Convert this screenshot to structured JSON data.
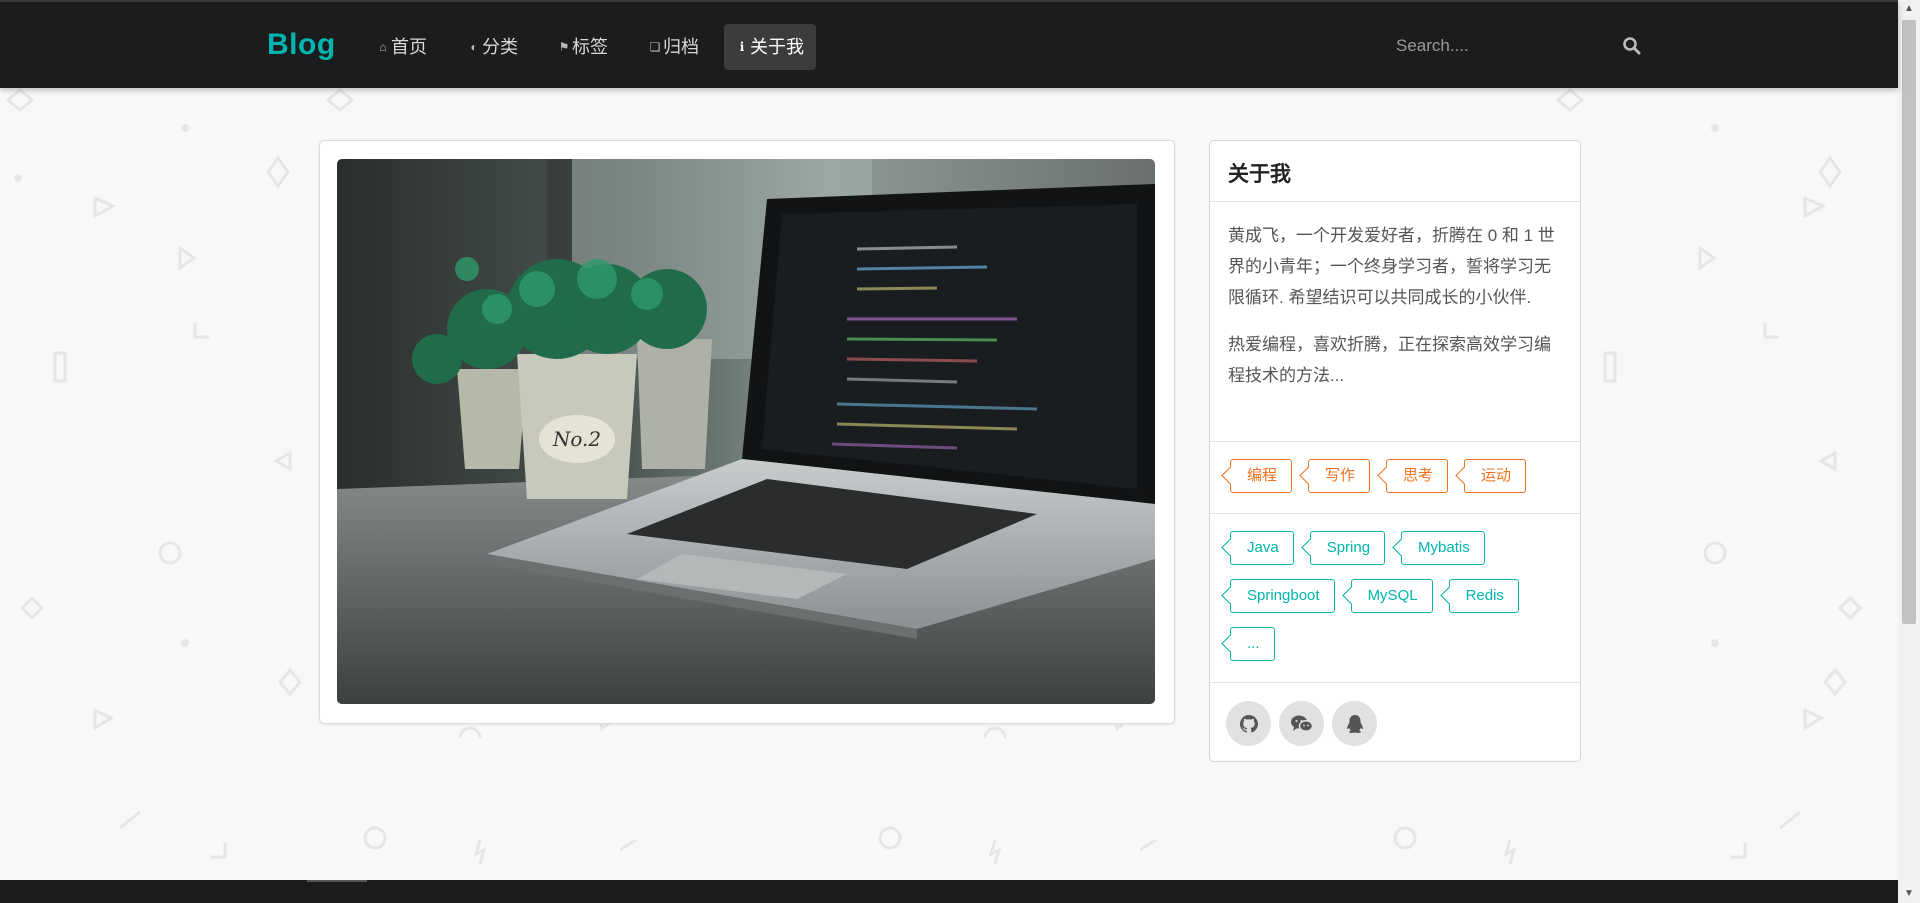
{
  "nav": {
    "brand": "Blog",
    "items": [
      {
        "label": "首页",
        "icon": "home-icon"
      },
      {
        "label": "分类",
        "icon": "idea-icon"
      },
      {
        "label": "标签",
        "icon": "tags-icon"
      },
      {
        "label": "归档",
        "icon": "clone-icon"
      },
      {
        "label": "关于我",
        "icon": "info-icon",
        "active": true
      }
    ],
    "search_placeholder": "Search...."
  },
  "about": {
    "title": "关于我",
    "paragraphs": [
      "黄成飞，一个开发爱好者，折腾在 0 和 1 世界的小青年；一个终身学习者，誓将学习无限循环. 希望结识可以共同成长的小伙伴.",
      "热爱编程，喜欢折腾，正在探索高效学习编程技术的方法..."
    ],
    "interest_tags": [
      "编程",
      "写作",
      "思考",
      "运动"
    ],
    "tech_tags": [
      "Java",
      "Spring",
      "Mybatis",
      "Springboot",
      "MySQL",
      "Redis",
      "..."
    ],
    "social": [
      "github-icon",
      "wechat-icon",
      "qq-icon"
    ]
  },
  "colors": {
    "accent": "#00b5ad",
    "orange": "#f2711c",
    "nav_bg": "#1b1c1d"
  }
}
